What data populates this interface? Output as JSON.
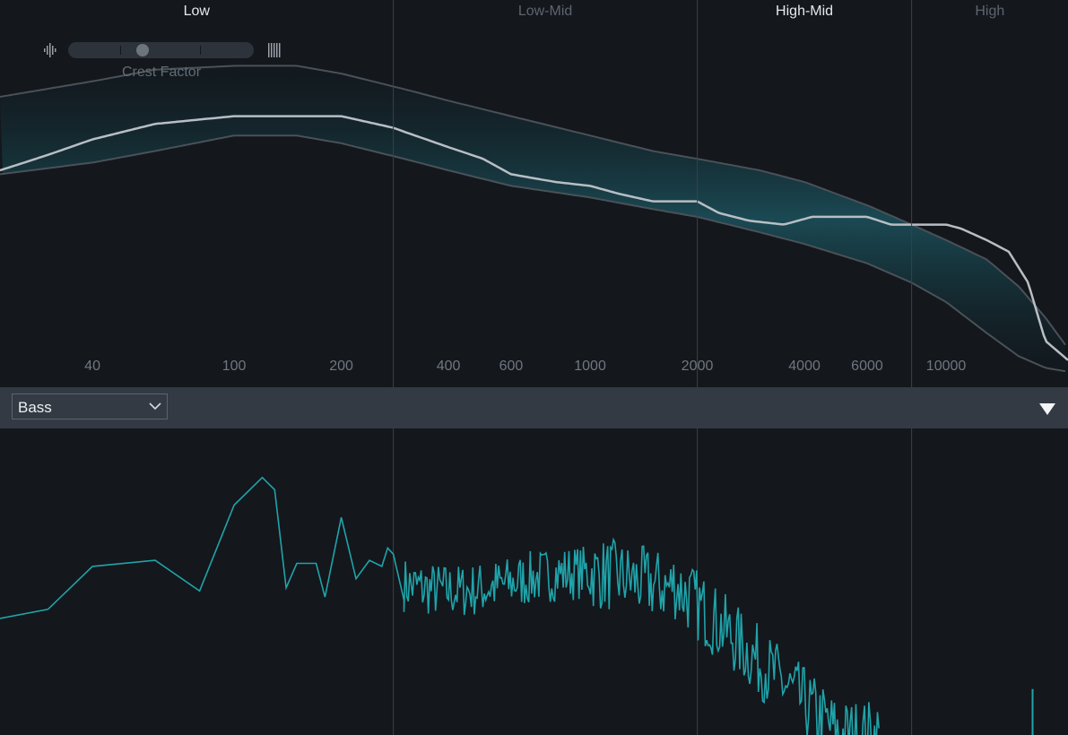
{
  "crest_factor": {
    "label": "Crest Factor",
    "position": 0.4
  },
  "preset": {
    "value": "Bass"
  },
  "colors": {
    "background": "#14171c",
    "band_fill": "#1b4c56",
    "band_edge": "#4a5158",
    "analysis_curve": "#b8bec4",
    "spectrum": "#1fa4aa",
    "divider": "#3a4047",
    "toolbar": "#333a44"
  },
  "chart_data": [
    {
      "type": "line",
      "title": "",
      "xscale": "log",
      "xlim": [
        22,
        22000
      ],
      "ylim": [
        0,
        1
      ],
      "bands": [
        {
          "name": "Low",
          "active": true,
          "from": 22,
          "to": 280
        },
        {
          "name": "Low-Mid",
          "active": false,
          "from": 280,
          "to": 2000
        },
        {
          "name": "High-Mid",
          "active": true,
          "from": 2000,
          "to": 8000
        },
        {
          "name": "High",
          "active": false,
          "from": 8000,
          "to": 22000
        }
      ],
      "tick_labels": [
        "40",
        "100",
        "200",
        "400",
        "600",
        "1000",
        "2000",
        "4000",
        "6000",
        "10000"
      ],
      "tick_values": [
        40,
        100,
        200,
        400,
        600,
        1000,
        2000,
        4000,
        6000,
        10000
      ],
      "target_band": {
        "x": [
          22,
          40,
          60,
          100,
          150,
          200,
          300,
          400,
          600,
          1000,
          1500,
          2000,
          3000,
          4000,
          6000,
          8000,
          10000,
          13000,
          16000,
          19000,
          22000
        ],
        "upper": [
          0.75,
          0.79,
          0.82,
          0.83,
          0.83,
          0.81,
          0.77,
          0.74,
          0.7,
          0.65,
          0.61,
          0.59,
          0.56,
          0.53,
          0.47,
          0.42,
          0.38,
          0.33,
          0.26,
          0.18,
          0.1
        ],
        "lower": [
          0.55,
          0.58,
          0.61,
          0.65,
          0.65,
          0.63,
          0.59,
          0.56,
          0.52,
          0.49,
          0.46,
          0.44,
          0.4,
          0.37,
          0.32,
          0.27,
          0.22,
          0.14,
          0.08,
          0.05,
          0.04
        ]
      },
      "analysis_curve": {
        "x": [
          22,
          30,
          40,
          60,
          100,
          150,
          200,
          280,
          300,
          400,
          500,
          600,
          800,
          1000,
          1200,
          1500,
          1800,
          2000,
          2300,
          2800,
          3500,
          4200,
          5000,
          6000,
          7000,
          8000,
          9000,
          10000,
          11000,
          13000,
          15000,
          17000,
          19000,
          22000
        ],
        "y": [
          0.56,
          0.6,
          0.64,
          0.68,
          0.7,
          0.7,
          0.7,
          0.67,
          0.66,
          0.62,
          0.59,
          0.55,
          0.53,
          0.52,
          0.5,
          0.48,
          0.48,
          0.48,
          0.45,
          0.43,
          0.42,
          0.44,
          0.44,
          0.44,
          0.42,
          0.42,
          0.42,
          0.42,
          0.41,
          0.38,
          0.35,
          0.27,
          0.12,
          0.07
        ]
      }
    },
    {
      "type": "line",
      "title": "",
      "xscale": "log",
      "xlim": [
        22,
        22000
      ],
      "ylim": [
        0,
        1
      ],
      "series": [
        {
          "x": [
            22,
            30,
            40,
            60,
            80,
            100,
            120,
            130,
            140,
            150,
            170,
            180,
            200,
            220,
            240,
            260,
            270,
            280,
            300
          ],
          "y": [
            0.38,
            0.41,
            0.55,
            0.57,
            0.47,
            0.75,
            0.84,
            0.8,
            0.48,
            0.56,
            0.56,
            0.45,
            0.71,
            0.51,
            0.57,
            0.55,
            0.61,
            0.59,
            0.44
          ]
        }
      ],
      "noise_from": 300,
      "noise_to": 6500,
      "impulse_x": 17500,
      "impulse_height": 0.15
    }
  ]
}
